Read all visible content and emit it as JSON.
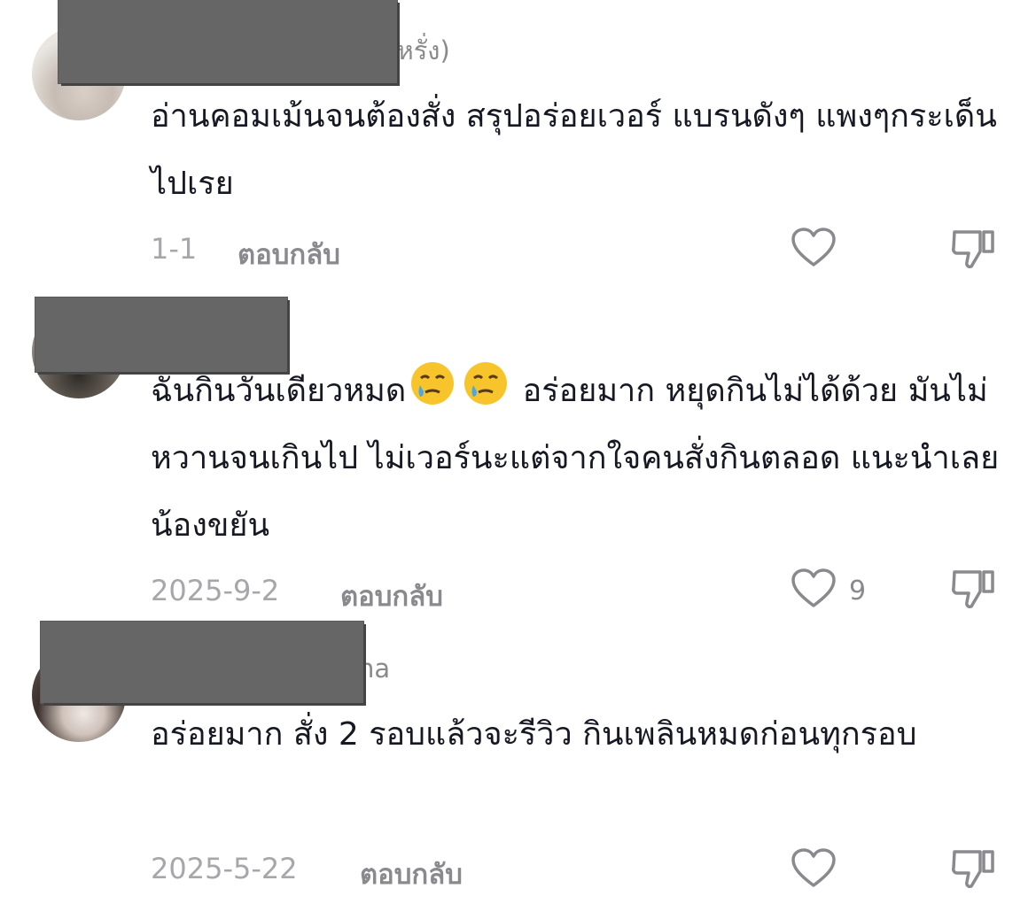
{
  "comments": [
    {
      "username_visible": "ำ(หรั่ง)",
      "text": "อ่านคอมเม้นจนต้องสั่ง สรุปอร่อยเวอร์ แบรนดังๆ แพงๆกระเด็นไปเรย",
      "date": "1-1",
      "reply_label": "ตอบกลับ",
      "likes": ""
    },
    {
      "username_visible": "",
      "text_before_emoji": "ฉันกินวันเดียวหมด",
      "text_after_emoji": "อร่อยมาก หยุดกินไม่ได้ด้วย มันไม่หวานจนเกินไป ไม่เวอร์นะแต่จากใจคนสั่งกินตลอด แนะนำเลยน้องขยัน",
      "emoji_name": "face-holding-back-tears",
      "date": "2025-9-2",
      "reply_label": "ตอบกลับ",
      "likes": "9"
    },
    {
      "username_visible": "na",
      "text": "อร่อยมาก สั่ง 2 รอบแล้วจะรีวิว กินเพลินหมดก่อนทุกรอบ",
      "date": "2025-5-22",
      "reply_label": "ตอบกลับ",
      "likes": ""
    }
  ],
  "icons": {
    "like": "heart-outline-icon",
    "dislike": "thumbs-down-outline-icon"
  },
  "colors": {
    "text": "#161823",
    "muted": "#a7a7ab",
    "action": "#8a8a8e",
    "redaction": "#666666"
  }
}
